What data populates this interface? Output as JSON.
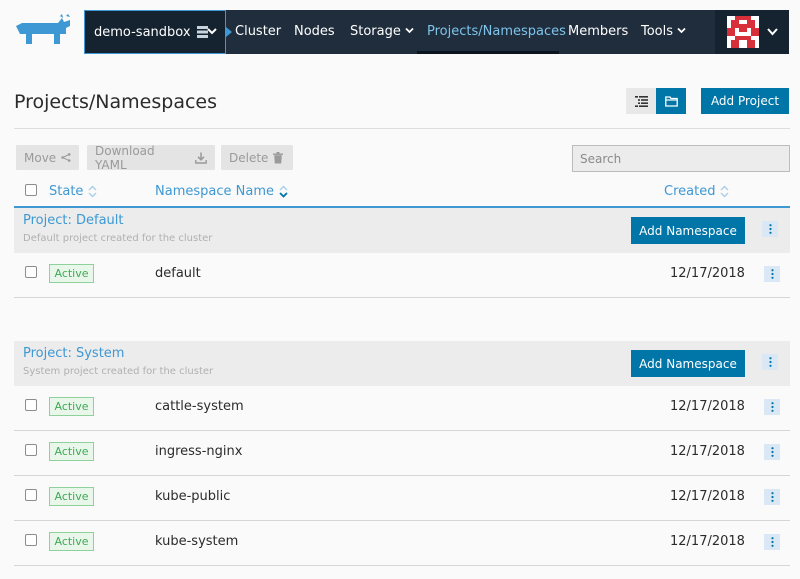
{
  "nav": {
    "cluster_name": "demo-sandbox",
    "items": [
      "Cluster",
      "Nodes",
      "Storage",
      "Projects/Namespaces",
      "Members",
      "Tools"
    ]
  },
  "page": {
    "title": "Projects/Namespaces",
    "add_project_label": "Add Project"
  },
  "toolbar": {
    "move_label": "Move",
    "download_label": "Download YAML",
    "delete_label": "Delete",
    "search_placeholder": "Search"
  },
  "table": {
    "columns": {
      "state": "State",
      "name": "Namespace Name",
      "created": "Created"
    }
  },
  "groups": [
    {
      "name": "Project: Default",
      "description": "Default project created for the cluster",
      "add_label": "Add Namespace",
      "rows": [
        {
          "state": "Active",
          "name": "default",
          "created": "12/17/2018"
        }
      ]
    },
    {
      "name": "Project: System",
      "description": "System project created for the cluster",
      "add_label": "Add Namespace",
      "rows": [
        {
          "state": "Active",
          "name": "cattle-system",
          "created": "12/17/2018"
        },
        {
          "state": "Active",
          "name": "ingress-nginx",
          "created": "12/17/2018"
        },
        {
          "state": "Active",
          "name": "kube-public",
          "created": "12/17/2018"
        },
        {
          "state": "Active",
          "name": "kube-system",
          "created": "12/17/2018"
        }
      ]
    }
  ],
  "colors": {
    "nav_bg": "#1f2d3d",
    "accent": "#3d98d3",
    "primary": "#0075a8",
    "active_badge": "#3fa956"
  }
}
